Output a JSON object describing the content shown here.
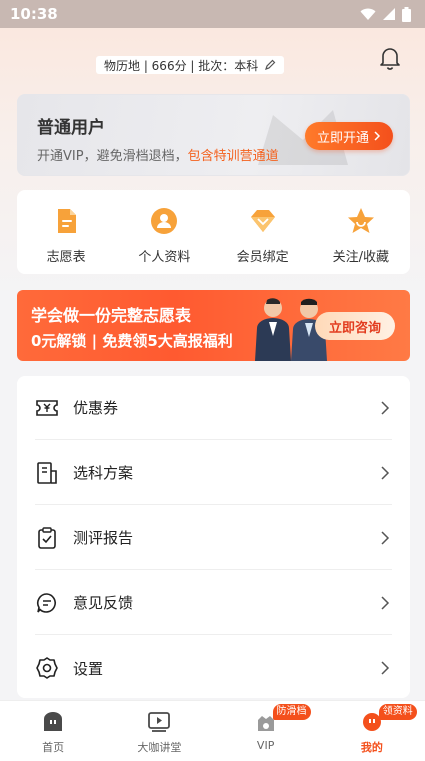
{
  "status_bar": {
    "time": "10:38"
  },
  "profile": {
    "line": "物历地 | 666分 | 批次：本科"
  },
  "member_card": {
    "title": "普通用户",
    "desc_prefix": "开通VIP，避免滑档退档，",
    "desc_highlight": "包含特训营通道",
    "button": "立即开通"
  },
  "quick_actions": [
    {
      "label": "志愿表",
      "icon": "document-icon"
    },
    {
      "label": "个人资料",
      "icon": "user-icon"
    },
    {
      "label": "会员绑定",
      "icon": "diamond-icon"
    },
    {
      "label": "关注/收藏",
      "icon": "star-icon"
    }
  ],
  "banner": {
    "line1": "学会做一份完整志愿表",
    "line2": "0元解锁 | 免费领5大高报福利",
    "button": "立即咨询"
  },
  "menu": [
    {
      "label": "优惠券",
      "icon": "coupon-icon"
    },
    {
      "label": "选科方案",
      "icon": "plan-icon"
    },
    {
      "label": "测评报告",
      "icon": "report-icon"
    },
    {
      "label": "意见反馈",
      "icon": "feedback-icon"
    },
    {
      "label": "设置",
      "icon": "gear-icon"
    }
  ],
  "tabbar": [
    {
      "label": "首页",
      "icon": "home-icon"
    },
    {
      "label": "大咖讲堂",
      "icon": "video-icon"
    },
    {
      "label": "VIP",
      "icon": "vip-icon",
      "badge": "防滑档"
    },
    {
      "label": "我的",
      "icon": "me-icon",
      "badge": "领资料",
      "active": true
    }
  ],
  "colors": {
    "accent": "#f4501c",
    "highlight": "#f4621f",
    "icon_orange": "#f7a23a"
  }
}
